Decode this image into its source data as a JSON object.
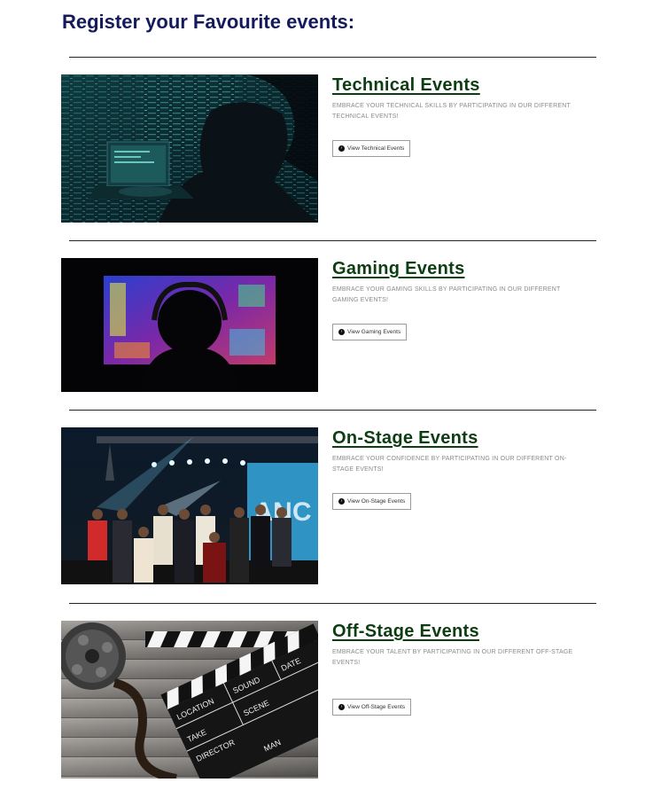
{
  "page": {
    "title": "Register your Favourite events:"
  },
  "events": [
    {
      "title": "Technical Events",
      "description": "EMBRACE YOUR TECHNICAL SKILLS BY PARTICIPATING IN OUR DIFFERENT TECHNICAL EVENTS!",
      "button_label": "View Technical Events",
      "image": "hacker-laptop-image"
    },
    {
      "title": "Gaming Events",
      "description": "EMBRACE YOUR GAMING SKILLS BY PARTICIPATING IN OUR DIFFERENT GAMING EVENTS!",
      "button_label": "View Gaming Events",
      "image": "gamer-monitor-image"
    },
    {
      "title": "On-Stage Events",
      "description": "EMBRACE YOUR CONFIDENCE BY PARTICIPATING IN OUR DIFFERENT ON-STAGE EVENTS!",
      "button_label": "View On-Stage Events",
      "image": "stage-performers-image"
    },
    {
      "title": "Off-Stage Events",
      "description": "EMBRACE YOUR TALENT BY PARTICIPATING IN OUR DIFFERENT OFF-STAGE EVENTS!",
      "button_label": "View Off-Stage Events",
      "image": "film-clapperboard-image"
    }
  ],
  "clapperboard_labels": {
    "location": "LOCATION",
    "sound": "SOUND",
    "date": "DATE",
    "take": "TAKE",
    "scene": "SCENE",
    "director": "DIRECTOR",
    "cameraman": "MAN"
  },
  "colors": {
    "page_title": "#141a5c",
    "event_title": "#0d3d12",
    "divider": "#222222"
  }
}
